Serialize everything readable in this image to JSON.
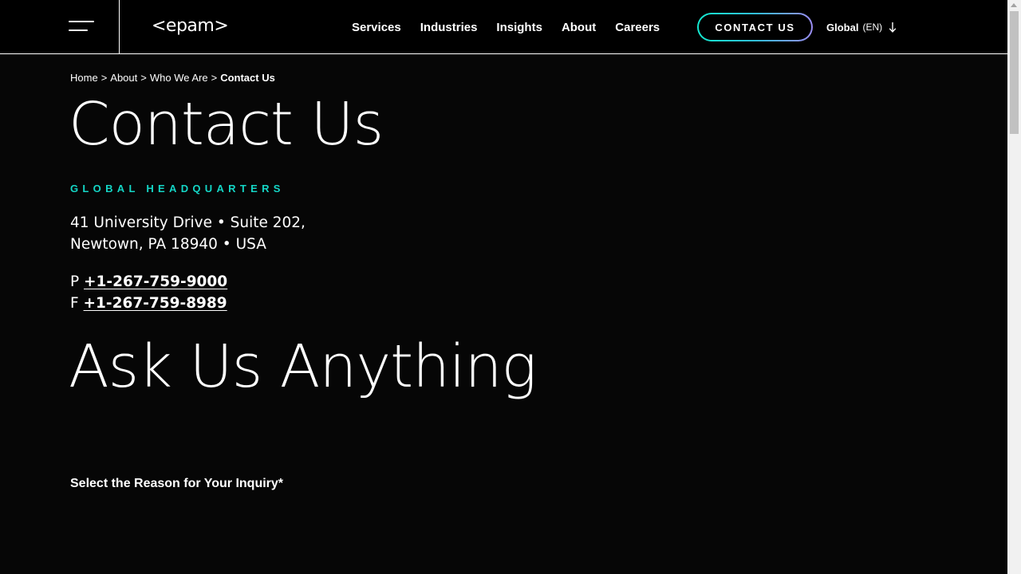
{
  "header": {
    "menu_icon": "hamburger-menu-icon",
    "logo_text": "<epam>",
    "nav": [
      {
        "label": "Services"
      },
      {
        "label": "Industries"
      },
      {
        "label": "Insights"
      },
      {
        "label": "About"
      },
      {
        "label": "Careers"
      }
    ],
    "contact_button": "CONTACT US",
    "language": {
      "name": "Global",
      "code": "(EN)",
      "icon": "arrow-down-icon"
    }
  },
  "breadcrumb": {
    "items": [
      "Home",
      "About",
      "Who We Are"
    ],
    "separator": ">",
    "current": "Contact Us"
  },
  "main": {
    "title": "Contact Us",
    "hq_heading": "GLOBAL HEADQUARTERS",
    "address_line1": "41 University Drive • Suite 202,",
    "address_line2": "Newtown, PA 18940 • USA",
    "phone_prefix": "P",
    "phone": "+1-267-759-9000",
    "fax_prefix": "F",
    "fax": "+1-267-759-8989",
    "ask_heading": "Ask Us Anything",
    "inquiry_label": "Select the Reason for Your Inquiry*"
  },
  "colors": {
    "background": "#060606",
    "accent": "#14d6c6",
    "button_gradient_start": "#13e8cf",
    "button_gradient_end": "#9b8cf2"
  }
}
